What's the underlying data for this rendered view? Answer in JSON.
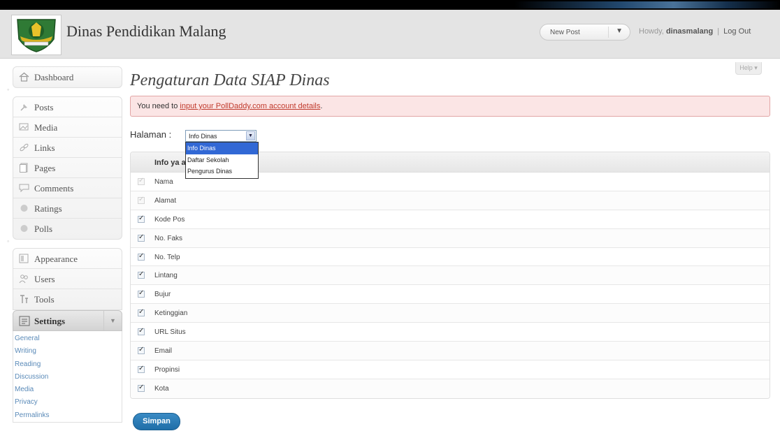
{
  "header": {
    "site_title": "Dinas Pendidikan Malang",
    "new_post": "New Post",
    "howdy_prefix": "Howdy,",
    "username": "dinasmalang",
    "separator": "|",
    "logout": "Log Out"
  },
  "sidebar": {
    "group1": [
      {
        "label": "Dashboard",
        "icon": "home-icon"
      }
    ],
    "group2": [
      {
        "label": "Posts",
        "icon": "pin-icon"
      },
      {
        "label": "Media",
        "icon": "media-icon"
      },
      {
        "label": "Links",
        "icon": "link-icon"
      },
      {
        "label": "Pages",
        "icon": "page-icon"
      },
      {
        "label": "Comments",
        "icon": "comment-icon"
      },
      {
        "label": "Ratings",
        "icon": "ratings-icon"
      },
      {
        "label": "Polls",
        "icon": "polls-icon"
      }
    ],
    "group3": [
      {
        "label": "Appearance",
        "icon": "appearance-icon"
      },
      {
        "label": "Users",
        "icon": "users-icon"
      },
      {
        "label": "Tools",
        "icon": "tools-icon"
      }
    ],
    "settings": {
      "label": "Settings",
      "toggle": "▼",
      "submenu": [
        "General",
        "Writing",
        "Reading",
        "Discussion",
        "Media",
        "Privacy",
        "Permalinks"
      ]
    }
  },
  "main": {
    "help": "Help ▾",
    "page_title": "Pengaturan Data SIAP Dinas",
    "notice_prefix": "You need to",
    "notice_link": "input your PollDaddy.com account details",
    "notice_suffix": ".",
    "halaman_label": "Halaman :",
    "select_value": "Info Dinas",
    "dropdown_options": [
      "Info Dinas",
      "Daftar Sekolah",
      "Pengurus Dinas"
    ],
    "table_header": "Info ya                          an",
    "fields": [
      {
        "label": "Nama",
        "checked": true,
        "disabled": true
      },
      {
        "label": "Alamat",
        "checked": true,
        "disabled": true
      },
      {
        "label": "Kode Pos",
        "checked": true,
        "disabled": false
      },
      {
        "label": "No. Faks",
        "checked": true,
        "disabled": false
      },
      {
        "label": "No. Telp",
        "checked": true,
        "disabled": false
      },
      {
        "label": "Lintang",
        "checked": true,
        "disabled": false
      },
      {
        "label": "Bujur",
        "checked": true,
        "disabled": false
      },
      {
        "label": "Ketinggian",
        "checked": true,
        "disabled": false
      },
      {
        "label": "URL Situs",
        "checked": true,
        "disabled": false
      },
      {
        "label": "Email",
        "checked": true,
        "disabled": false
      },
      {
        "label": "Propinsi",
        "checked": true,
        "disabled": false
      },
      {
        "label": "Kota",
        "checked": true,
        "disabled": false
      }
    ],
    "save_label": "Simpan"
  },
  "colors": {
    "notice_bg": "#fbe5e5",
    "notice_border": "#e2a6a6",
    "link_red": "#c0392b",
    "submenu_link": "#5a8ab8",
    "button_blue": "#2a7cb8",
    "dropdown_selected": "#3168d5"
  }
}
